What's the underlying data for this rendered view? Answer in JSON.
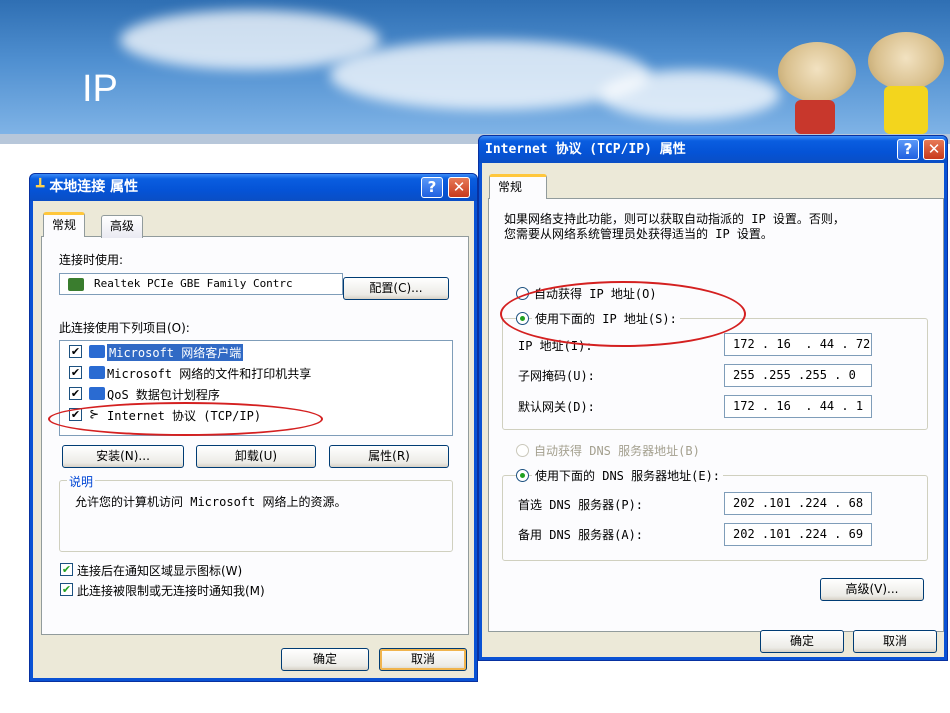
{
  "slide": {
    "title": "IP"
  },
  "left_dialog": {
    "title": "本地连接 属性",
    "help_glyph": "?",
    "close_glyph": "✕",
    "tabs": [
      "常规",
      "高级"
    ],
    "connect_using_label": "连接时使用:",
    "adapter_name": "Realtek PCIe GBE Family Contrc",
    "configure_button": "配置(C)...",
    "items_label": "此连接使用下列项目(O):",
    "items": [
      {
        "label": "Microsoft 网络客户端",
        "checked": true,
        "selected": true
      },
      {
        "label": "Microsoft 网络的文件和打印机共享",
        "checked": true,
        "selected": false
      },
      {
        "label": "QoS 数据包计划程序",
        "checked": true,
        "selected": false
      },
      {
        "label": "Internet 协议 (TCP/IP)",
        "checked": true,
        "selected": false
      }
    ],
    "install_button": "安装(N)...",
    "uninstall_button": "卸载(U)",
    "properties_button": "属性(R)",
    "description_group": "说明",
    "description_text": "允许您的计算机访问 Microsoft 网络上的资源。",
    "show_icon_checkbox": "连接后在通知区域显示图标(W)",
    "notify_checkbox": "此连接被限制或无连接时通知我(M)",
    "ok_button": "确定",
    "cancel_button": "取消"
  },
  "right_dialog": {
    "title": "Internet 协议 (TCP/IP) 属性",
    "help_glyph": "?",
    "close_glyph": "✕",
    "tab": "常规",
    "intro_line1": "如果网络支持此功能，则可以获取自动指派的 IP 设置。否则，",
    "intro_line2": "您需要从网络系统管理员处获得适当的 IP 设置。",
    "auto_ip_radio": "自动获得 IP 地址(O)",
    "manual_ip_radio": "使用下面的 IP 地址(S):",
    "ip_label": "IP 地址(I):",
    "ip_value": "172 . 16  . 44 . 72",
    "mask_label": "子网掩码(U):",
    "mask_value": "255 .255 .255 . 0",
    "gateway_label": "默认网关(D):",
    "gateway_value": "172 . 16  . 44 . 1",
    "auto_dns_radio": "自动获得 DNS 服务器地址(B)",
    "manual_dns_radio": "使用下面的 DNS 服务器地址(E):",
    "pref_dns_label": "首选 DNS 服务器(P):",
    "pref_dns_value": "202 .101 .224 . 68",
    "alt_dns_label": "备用 DNS 服务器(A):",
    "alt_dns_value": "202 .101 .224 . 69",
    "advanced_button": "高级(V)...",
    "ok_button": "确定",
    "cancel_button": "取消"
  },
  "colors": {
    "annotation": "#d42020",
    "xp_blue": "#0a52d4",
    "dialog_bg": "#ece9d8"
  }
}
